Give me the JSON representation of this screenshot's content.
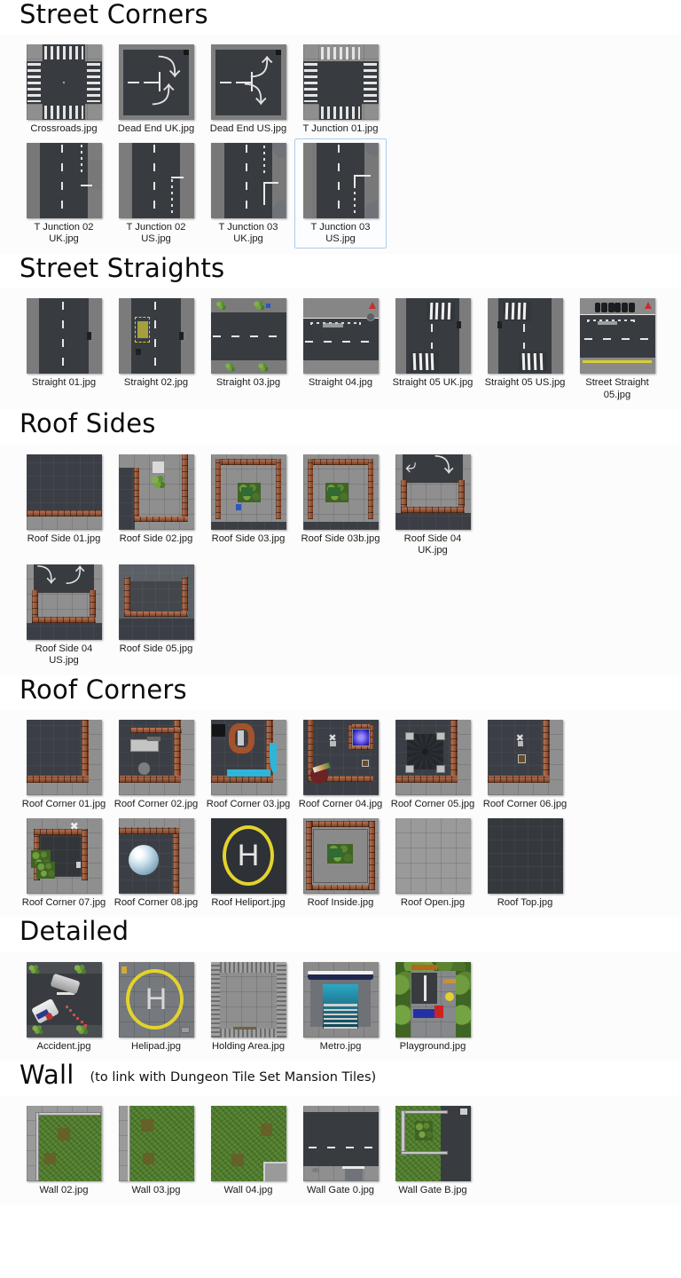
{
  "document": {
    "title": "Street Corners"
  },
  "sections": [
    {
      "id": "street-corners",
      "title": "Street Corners",
      "note": "",
      "rows": [
        {
          "items": [
            {
              "label": "Crossroads.jpg",
              "art": "crossroads",
              "selected": false
            },
            {
              "label": "Dead End UK.jpg",
              "art": "deadend-uk",
              "selected": false
            },
            {
              "label": "Dead End US.jpg",
              "art": "deadend-us",
              "selected": false
            },
            {
              "label": "T Junction 01.jpg",
              "art": "tjunction01",
              "selected": false
            }
          ]
        },
        {
          "items": [
            {
              "label": "T Junction 02 UK.jpg",
              "art": "tj02uk",
              "selected": false
            },
            {
              "label": "T Junction 02 US.jpg",
              "art": "tj02us",
              "selected": false
            },
            {
              "label": "T Junction 03 UK.jpg",
              "art": "tj03uk",
              "selected": false
            },
            {
              "label": "T Junction 03 US.jpg",
              "art": "tj03us",
              "selected": true
            }
          ]
        }
      ]
    },
    {
      "id": "street-straights",
      "title": "Street Straights",
      "note": "",
      "rows": [
        {
          "items": [
            {
              "label": "Straight 01.jpg",
              "art": "straight01",
              "selected": false
            },
            {
              "label": "Straight 02.jpg",
              "art": "straight02",
              "selected": false
            },
            {
              "label": "Straight 03.jpg",
              "art": "straight03",
              "selected": false
            },
            {
              "label": "Straight 04.jpg",
              "art": "straight04",
              "selected": false
            },
            {
              "label": "Straight 05 UK.jpg",
              "art": "straight05uk",
              "selected": false
            },
            {
              "label": "Straight 05 US.jpg",
              "art": "straight05us",
              "selected": false
            },
            {
              "label": "Street Straight 05.jpg",
              "art": "streetstraight05",
              "selected": false
            }
          ]
        }
      ]
    },
    {
      "id": "roof-sides",
      "title": "Roof Sides",
      "note": "",
      "rows": [
        {
          "items": [
            {
              "label": "Roof Side 01.jpg",
              "art": "roofside01",
              "selected": false
            },
            {
              "label": "Roof Side 02.jpg",
              "art": "roofside02",
              "selected": false
            },
            {
              "label": "Roof Side 03.jpg",
              "art": "roofside03",
              "selected": false
            },
            {
              "label": "Roof Side 03b.jpg",
              "art": "roofside03b",
              "selected": false
            },
            {
              "label": "Roof Side 04 UK.jpg",
              "art": "roofside04uk",
              "selected": false
            }
          ]
        },
        {
          "items": [
            {
              "label": "Roof Side 04 US.jpg",
              "art": "roofside04us",
              "selected": false
            },
            {
              "label": "Roof Side 05.jpg",
              "art": "roofside05",
              "selected": false
            }
          ]
        }
      ]
    },
    {
      "id": "roof-corners",
      "title": "Roof Corners",
      "note": "",
      "rows": [
        {
          "items": [
            {
              "label": "Roof Corner 01.jpg",
              "art": "rc01",
              "selected": false
            },
            {
              "label": "Roof Corner 02.jpg",
              "art": "rc02",
              "selected": false
            },
            {
              "label": "Roof Corner 03.jpg",
              "art": "rc03",
              "selected": false
            },
            {
              "label": "Roof Corner 04.jpg",
              "art": "rc04",
              "selected": false
            },
            {
              "label": "Roof Corner 05.jpg",
              "art": "rc05",
              "selected": false
            },
            {
              "label": "Roof Corner 06.jpg",
              "art": "rc06",
              "selected": false
            }
          ]
        },
        {
          "items": [
            {
              "label": "Roof Corner 07.jpg",
              "art": "rc07",
              "selected": false
            },
            {
              "label": "Roof Corner 08.jpg",
              "art": "rc08",
              "selected": false
            },
            {
              "label": "Roof Heliport.jpg",
              "art": "heliport",
              "selected": false
            },
            {
              "label": "Roof Inside.jpg",
              "art": "roofinside",
              "selected": false
            },
            {
              "label": "Roof Open.jpg",
              "art": "roofopen",
              "selected": false
            },
            {
              "label": "Roof Top.jpg",
              "art": "rooftop",
              "selected": false
            }
          ]
        }
      ]
    },
    {
      "id": "detailed",
      "title": "Detailed",
      "note": "",
      "rows": [
        {
          "items": [
            {
              "label": "Accident.jpg",
              "art": "accident",
              "selected": false
            },
            {
              "label": "Helipad.jpg",
              "art": "helipad",
              "selected": false
            },
            {
              "label": "Holding Area.jpg",
              "art": "holdingarea",
              "selected": false
            },
            {
              "label": "Metro.jpg",
              "art": "metro",
              "selected": false
            },
            {
              "label": "Playground.jpg",
              "art": "playground",
              "selected": false
            }
          ]
        }
      ]
    },
    {
      "id": "wall",
      "title": "Wall",
      "note": "(to link with Dungeon Tile Set Mansion Tiles)",
      "rows": [
        {
          "items": [
            {
              "label": "Wall 02.jpg",
              "art": "wall02",
              "selected": false
            },
            {
              "label": "Wall 03.jpg",
              "art": "wall03",
              "selected": false
            },
            {
              "label": "Wall 04.jpg",
              "art": "wall04",
              "selected": false
            },
            {
              "label": "Wall Gate 0.jpg",
              "art": "wallgate0",
              "selected": false
            },
            {
              "label": "Wall Gate B.jpg",
              "art": "wallgateb",
              "selected": false
            }
          ]
        }
      ]
    }
  ],
  "colors": {
    "page_background": "#ffffff",
    "panel_background": "#fcfcfc",
    "selection_border": "#aeccea",
    "text": "#1b1b1b",
    "heading": "#0a0a0a",
    "asphalt": "#43474c",
    "pavement": "#8f8f8f",
    "brick": "#a4522c",
    "grass": "#517f2c",
    "road_marking": "#e9e9e9",
    "yellow_marking": "#d8cf32"
  }
}
